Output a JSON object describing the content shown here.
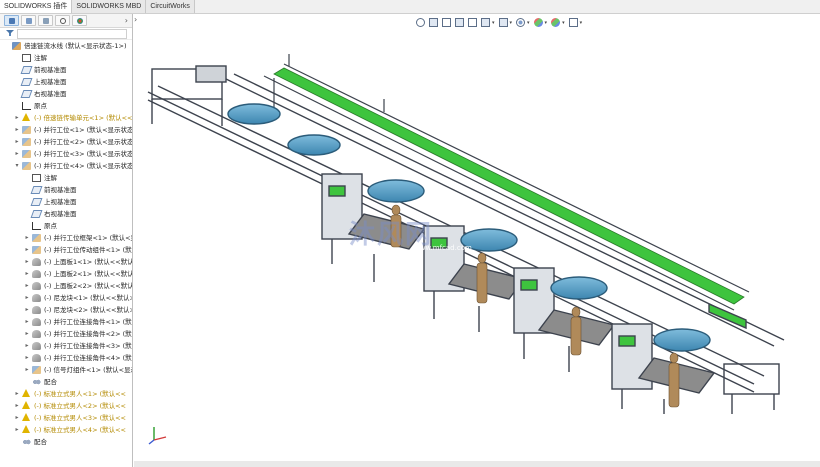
{
  "tabs": [
    {
      "label": "SOLIDWORKS 插件",
      "active": true
    },
    {
      "label": "SOLIDWORKS MBD",
      "active": false
    },
    {
      "label": "CircuitWorks",
      "active": false
    }
  ],
  "pane": {
    "tool_icons": [
      "feature-manager-icon",
      "property-manager-icon",
      "configuration-manager-icon",
      "dimxpert-icon",
      "display-manager-icon"
    ],
    "more_arrow": "›",
    "filter_placeholder": ""
  },
  "tree": [
    {
      "indent": 0,
      "arrow": "",
      "icon": "root",
      "label": "倍速链流水线  (默认<显示状态-1>)",
      "warn": false
    },
    {
      "indent": 1,
      "arrow": "",
      "icon": "note",
      "label": "注解",
      "warn": false
    },
    {
      "indent": 1,
      "arrow": "",
      "icon": "plane",
      "label": "前视基准面",
      "warn": false
    },
    {
      "indent": 1,
      "arrow": "",
      "icon": "plane",
      "label": "上视基准面",
      "warn": false
    },
    {
      "indent": 1,
      "arrow": "",
      "icon": "plane",
      "label": "右视基准面",
      "warn": false
    },
    {
      "indent": 1,
      "arrow": "",
      "icon": "origin",
      "label": "原点",
      "warn": false
    },
    {
      "indent": 1,
      "arrow": "▸",
      "icon": "warnic",
      "label": "(-) 倍速链传输单元<1> (默认<<默",
      "warn": true
    },
    {
      "indent": 1,
      "arrow": "▸",
      "icon": "asm",
      "label": "(-) 并行工位<1> (默认<显示状态-",
      "warn": false
    },
    {
      "indent": 1,
      "arrow": "▸",
      "icon": "asm",
      "label": "(-) 并行工位<2> (默认<显示状态-",
      "warn": false
    },
    {
      "indent": 1,
      "arrow": "▸",
      "icon": "asm",
      "label": "(-) 并行工位<3> (默认<显示状态-",
      "warn": false
    },
    {
      "indent": 1,
      "arrow": "▾",
      "icon": "asm",
      "label": "(-) 并行工位<4> (默认<显示状态-1>",
      "warn": false
    },
    {
      "indent": 2,
      "arrow": "",
      "icon": "note",
      "label": "注解",
      "warn": false
    },
    {
      "indent": 2,
      "arrow": "",
      "icon": "plane",
      "label": "前视基准面",
      "warn": false
    },
    {
      "indent": 2,
      "arrow": "",
      "icon": "plane",
      "label": "上视基准面",
      "warn": false
    },
    {
      "indent": 2,
      "arrow": "",
      "icon": "plane",
      "label": "右视基准面",
      "warn": false
    },
    {
      "indent": 2,
      "arrow": "",
      "icon": "origin",
      "label": "原点",
      "warn": false
    },
    {
      "indent": 2,
      "arrow": "▸",
      "icon": "asm",
      "label": "(-) 并行工位框架<1> (默认<显",
      "warn": false
    },
    {
      "indent": 2,
      "arrow": "▸",
      "icon": "asm",
      "label": "(-) 并行工位传动组件<1> (默认",
      "warn": false
    },
    {
      "indent": 2,
      "arrow": "▸",
      "icon": "part",
      "label": "(-) 上面板1<1> (默认<<默认>",
      "warn": false
    },
    {
      "indent": 2,
      "arrow": "▸",
      "icon": "part",
      "label": "(-) 上面板2<1> (默认<<默认>",
      "warn": false
    },
    {
      "indent": 2,
      "arrow": "▸",
      "icon": "part",
      "label": "(-) 上面板2<2> (默认<<默认>",
      "warn": false
    },
    {
      "indent": 2,
      "arrow": "▸",
      "icon": "part",
      "label": "(-) 尼龙块<1> (默认<<默认>_",
      "warn": false
    },
    {
      "indent": 2,
      "arrow": "▸",
      "icon": "part",
      "label": "(-) 尼龙块<2> (默认<<默认>_",
      "warn": false
    },
    {
      "indent": 2,
      "arrow": "▸",
      "icon": "part",
      "label": "(-) 并行工位连接角件<1> (默认",
      "warn": false
    },
    {
      "indent": 2,
      "arrow": "▸",
      "icon": "part",
      "label": "(-) 并行工位连接角件<2> (默认",
      "warn": false
    },
    {
      "indent": 2,
      "arrow": "▸",
      "icon": "part",
      "label": "(-) 并行工位连接角件<3> (默认",
      "warn": false
    },
    {
      "indent": 2,
      "arrow": "▸",
      "icon": "part",
      "label": "(-) 并行工位连接角件<4> (默认",
      "warn": false
    },
    {
      "indent": 2,
      "arrow": "▸",
      "icon": "asm",
      "label": "(-) 信号灯组件<1> (默认<显示",
      "warn": false
    },
    {
      "indent": 2,
      "arrow": "",
      "icon": "mate",
      "label": "配合",
      "warn": false
    },
    {
      "indent": 1,
      "arrow": "▸",
      "icon": "warnic",
      "label": "(-) 标准立式男人<1> (默认<<",
      "warn": true
    },
    {
      "indent": 1,
      "arrow": "▸",
      "icon": "warnic",
      "label": "(-) 标准立式男人<2> (默认<<",
      "warn": true
    },
    {
      "indent": 1,
      "arrow": "▸",
      "icon": "warnic",
      "label": "(-) 标准立式男人<3> (默认<<",
      "warn": true
    },
    {
      "indent": 1,
      "arrow": "▸",
      "icon": "warnic",
      "label": "(-) 标准立式男人<4> (默认<<",
      "warn": true
    },
    {
      "indent": 1,
      "arrow": "",
      "icon": "mate",
      "label": "配合",
      "warn": false
    }
  ],
  "heads_up": [
    "zoom-fit-icon",
    "zoom-area-icon",
    "previous-view-icon",
    "section-view-icon",
    "dynamic-annotation-icon",
    "view-orientation-icon",
    "display-style-icon",
    "hide-show-icon",
    "edit-appearance-icon",
    "apply-scene-icon",
    "view-settings-icon"
  ],
  "watermark": {
    "main": "沐风网",
    "sub": "www.mfcad.com"
  },
  "colors": {
    "frame": "#4a4f5a",
    "green": "#3ec43e",
    "tabletop": "#8c8c8c",
    "disc": "#5aa3c8",
    "figure": "#b08a5a"
  }
}
